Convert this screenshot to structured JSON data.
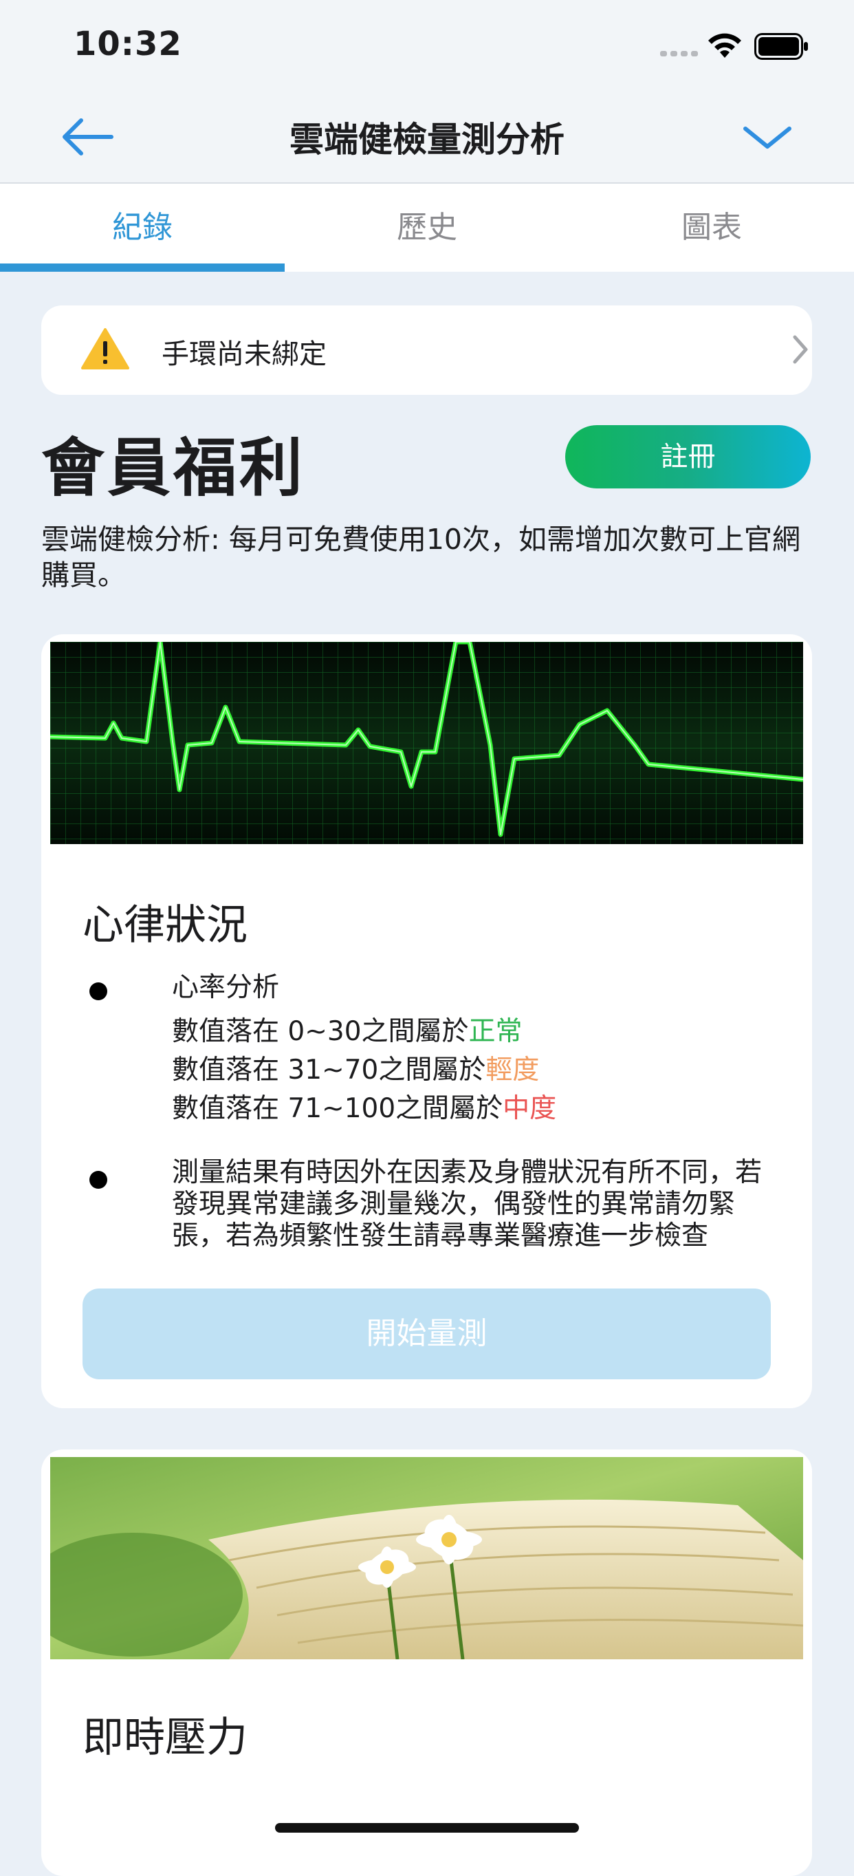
{
  "status_bar": {
    "time": "10:32"
  },
  "nav": {
    "title": "雲端健檢量測分析"
  },
  "tabs": [
    {
      "label": "紀錄",
      "active": true
    },
    {
      "label": "歷史",
      "active": false
    },
    {
      "label": "圖表",
      "active": false
    }
  ],
  "alert": {
    "text": "手環尚未綁定",
    "icon": "warning-icon"
  },
  "membership": {
    "title": "會員福利",
    "register_label": "註冊",
    "description": "雲端健檢分析: 每月可免費使用10次，如需增加次數可上官網購買。"
  },
  "cards": [
    {
      "title": "心律狀況",
      "bullet1": {
        "heading": "心率分析",
        "lines": [
          {
            "prefix": "數值落在 0~30之間屬於",
            "level": "正常"
          },
          {
            "prefix": "數值落在 31~70之間屬於",
            "level": "輕度"
          },
          {
            "prefix": "數值落在 71~100之間屬於",
            "level": "中度"
          }
        ]
      },
      "bullet2": "測量結果有時因外在因素及身體狀況有所不同，若發現異常建議多測量幾次，偶發性的異常請勿緊張，若為頻繁性發生請尋專業醫療進一步檢查",
      "button_label": "開始量測"
    },
    {
      "title": "即時壓力"
    }
  ],
  "colors": {
    "accent": "#2f96d6",
    "normal": "#2fb552",
    "light": "#f29c5f",
    "moderate": "#ea5453",
    "button_disabled": "#bfe1f4"
  }
}
